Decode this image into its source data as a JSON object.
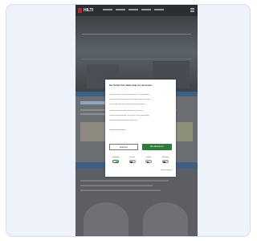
{
  "site": {
    "logo_text": "HILTI"
  },
  "cookie_modal": {
    "title": "Der Schutz Ihrer Daten liegt uns am Herzen",
    "paragraphs": [
      "Wir verwenden Cookies und ähnliche Technologien,",
      "um Ihnen die bestmögliche Nutzung unserer Website",
      "zu ermöglichen und Inhalte zu personalisieren.",
      "Weitere Informationen finden Sie in unserer",
      "Datenschutzerklärung. Sie können Ihre Einwilligung",
      "jederzeit widerrufen oder anpassen.",
      "Cookie-Einstellungen"
    ],
    "reject_button": "Ablehnen",
    "accept_button": "Alle akzeptieren",
    "categories": [
      {
        "label": "Notwendig",
        "enabled": true
      },
      {
        "label": "Statistik",
        "enabled": false
      },
      {
        "label": "Komfort",
        "enabled": false
      },
      {
        "label": "Marketing",
        "enabled": false
      }
    ],
    "footer_link": "Details anzeigen"
  },
  "colors": {
    "accent_green": "#2f7d38",
    "brand_red": "#c8202a",
    "nav_blue": "#3c5f86"
  }
}
